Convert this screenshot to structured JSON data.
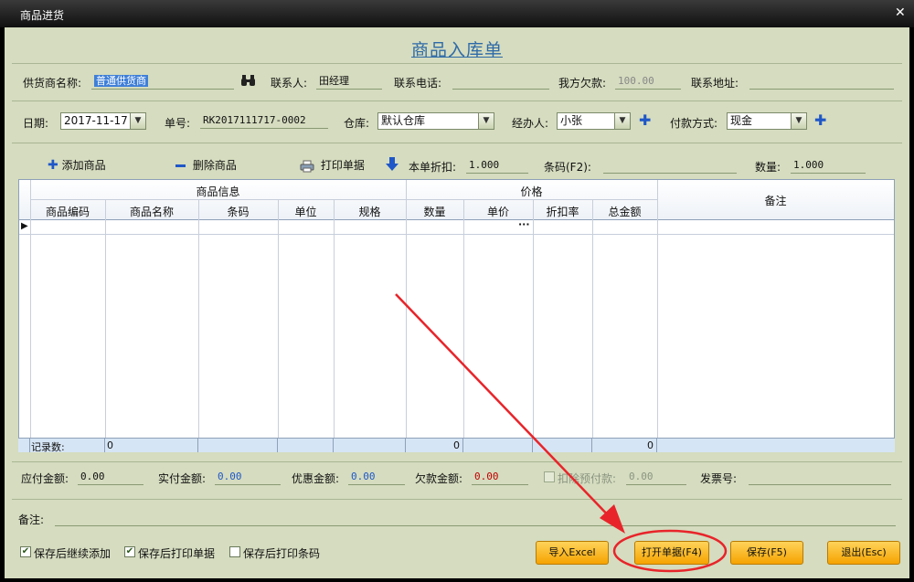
{
  "window": {
    "title": "商品进货",
    "close_glyph": "✕"
  },
  "form_title": "商品入库单",
  "row1": {
    "supplier_label": "供货商名称:",
    "supplier_value": "普通供货商",
    "contact_label": "联系人:",
    "contact_value": "田经理",
    "phone_label": "联系电话:",
    "phone_value": "",
    "owed_label": "我方欠款:",
    "owed_value": "100.00",
    "address_label": "联系地址:",
    "address_value": ""
  },
  "row2": {
    "date_label": "日期:",
    "date_value": "2017-11-17",
    "order_label": "单号:",
    "order_value": "RK2017111717-0002",
    "warehouse_label": "仓库:",
    "warehouse_value": "默认仓库",
    "handler_label": "经办人:",
    "handler_value": "小张",
    "payment_label": "付款方式:",
    "payment_value": "现金"
  },
  "toolbar": {
    "add_label": "添加商品",
    "delete_label": "删除商品",
    "print_label": "打印单据",
    "discount_label": "本单折扣:",
    "discount_value": "1.000",
    "barcode_label": "条码(F2):",
    "barcode_value": "",
    "qty_label": "数量:",
    "qty_value": "1.000"
  },
  "grid": {
    "group_product": "商品信息",
    "group_price": "价格",
    "remark": "备注",
    "columns": [
      "商品编码",
      "商品名称",
      "条码",
      "单位",
      "规格",
      "数量",
      "单价",
      "折扣率",
      "总金额"
    ],
    "ellipsis": "···",
    "footer_label": "记录数:",
    "footer_count": "0",
    "footer_qty": "0",
    "footer_total": "0"
  },
  "summary": {
    "payable_label": "应付金额:",
    "payable_value": "0.00",
    "paid_label": "实付金额:",
    "paid_value": "0.00",
    "discount_label": "优惠金额:",
    "discount_value": "0.00",
    "owe_label": "欠款金额:",
    "owe_value": "0.00",
    "prepay_label": "扣除预付款:",
    "prepay_value": "0.00",
    "invoice_label": "发票号:",
    "invoice_value": ""
  },
  "remark_label": "备注:",
  "options": {
    "continue_label": "保存后继续添加",
    "continue_checked": true,
    "print_doc_label": "保存后打印单据",
    "print_doc_checked": true,
    "print_barcode_label": "保存后打印条码",
    "print_barcode_checked": false
  },
  "buttons": {
    "import": "导入Excel",
    "open": "打开单据(F4)",
    "save": "保存(F5)",
    "exit": "退出(Esc)"
  },
  "colors": {
    "body_bg": "#d5dcbf",
    "title_blue": "#2e6aa8",
    "accent_blue": "#1f57c8",
    "button_orange": "#f5a300",
    "annotation_red": "#e8242a",
    "owe_red": "#c00000"
  }
}
